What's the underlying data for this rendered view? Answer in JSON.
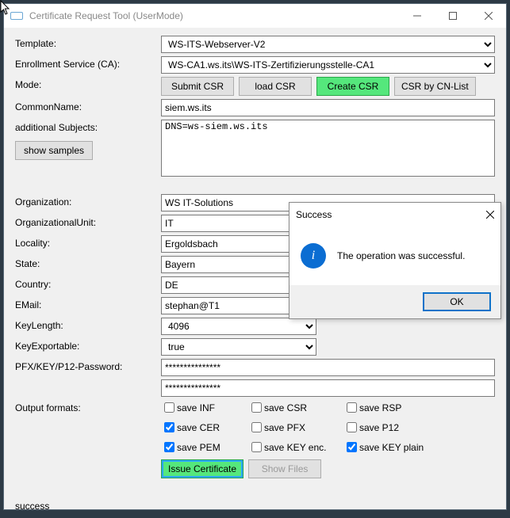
{
  "window": {
    "title": "Certificate Request Tool (UserMode)"
  },
  "labels": {
    "template": "Template:",
    "enrollment": "Enrollment Service (CA):",
    "mode": "Mode:",
    "commonname": "CommonName:",
    "addsubj": "additional Subjects:",
    "show_samples": "show samples",
    "organization": "Organization:",
    "ou": "OrganizationalUnit:",
    "locality": "Locality:",
    "state": "State:",
    "country": "Country:",
    "email": "EMail:",
    "keylength": "KeyLength:",
    "keyexportable": "KeyExportable:",
    "pfxpass": "PFX/KEY/P12-Password:",
    "outputformats": "Output formats:"
  },
  "buttons": {
    "submit_csr": "Submit CSR",
    "load_csr": "load CSR",
    "create_csr": "Create CSR",
    "csr_by_cnlist": "CSR by CN-List",
    "issue_cert": "Issue Certificate",
    "show_files": "Show Files"
  },
  "values": {
    "template": "WS-ITS-Webserver-V2",
    "enrollment": "WS-CA1.ws.its\\WS-ITS-Zertifizierungsstelle-CA1",
    "commonname": "siem.ws.its",
    "addsubj": "DNS=ws-siem.ws.its",
    "organization": "WS IT-Solutions",
    "ou": "IT",
    "locality": "Ergoldsbach",
    "state": "Bayern",
    "country": "DE",
    "email": "stephan@T1",
    "keylength": "4096",
    "keyexportable": "true",
    "pfxpass1": "***************",
    "pfxpass2": "***************"
  },
  "checkboxes": {
    "save_inf": {
      "label": "save INF",
      "checked": false
    },
    "save_csr": {
      "label": "save CSR",
      "checked": false
    },
    "save_rsp": {
      "label": "save RSP",
      "checked": false
    },
    "save_cer": {
      "label": "save CER",
      "checked": true
    },
    "save_pfx": {
      "label": "save PFX",
      "checked": false
    },
    "save_p12": {
      "label": "save P12",
      "checked": false
    },
    "save_pem": {
      "label": "save PEM",
      "checked": true
    },
    "save_keyenc": {
      "label": "save KEY enc.",
      "checked": false
    },
    "save_keyplain": {
      "label": "save KEY plain",
      "checked": true
    }
  },
  "status": "success",
  "dialog": {
    "title": "Success",
    "message": "The operation was successful.",
    "ok": "OK"
  }
}
